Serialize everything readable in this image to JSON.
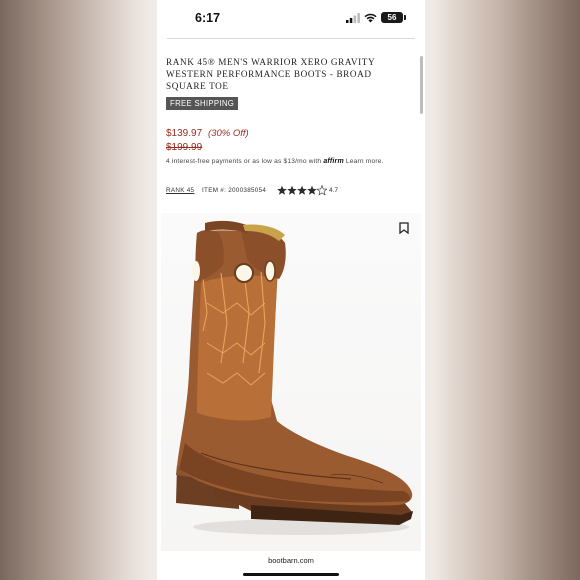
{
  "status_bar": {
    "time": "6:17",
    "battery": "56"
  },
  "product": {
    "title": "RANK 45® MEN'S WARRIOR XERO GRAVITY WESTERN PERFORMANCE BOOTS - BROAD SQUARE TOE",
    "badge": "FREE SHIPPING",
    "price": "$139.97",
    "discount": "(30% Off)",
    "original_price": "$199.99",
    "affirm": {
      "text_before": "4 interest-free payments or as low as $13/mo with",
      "logo": "affirm",
      "text_after": "Learn more."
    },
    "brand_link": "RANK 45",
    "item_number": "ITEM #: 2000385054",
    "rating": "4.7"
  },
  "footer": {
    "url": "bootbarn.com"
  },
  "colors": {
    "price": "#9b2c1e",
    "badge_bg": "#555555"
  },
  "icons": [
    "bookmark-icon",
    "star-icon",
    "signal-icon",
    "wifi-icon",
    "battery-icon"
  ]
}
